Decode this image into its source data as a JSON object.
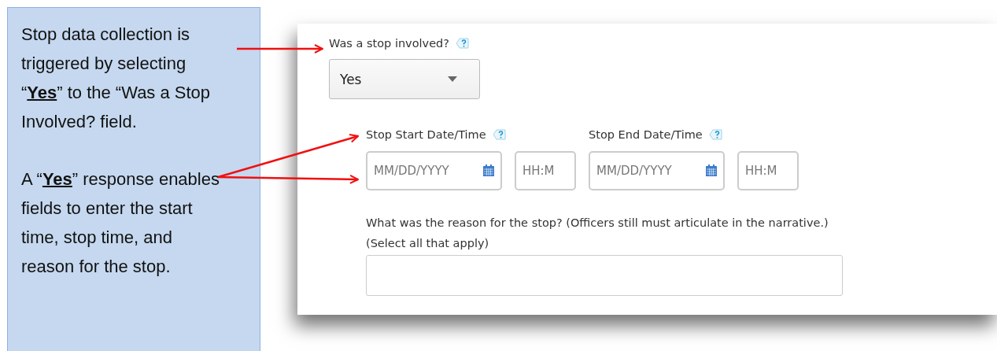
{
  "callout": {
    "paragraphs": [
      "Stop data collection is triggered by selecting “**Yes**” to the “Was a Stop Involved? field.",
      "A “**Yes**” response enables fields to enter the start time, stop time, and reason for the stop."
    ]
  },
  "form": {
    "stop_involved": {
      "label": "Was a stop involved?",
      "value": "Yes"
    },
    "date_times": [
      {
        "label": "Stop Start Date/Time",
        "date_placeholder": "MM/DD/YYYY",
        "time_placeholder": "HH:M"
      },
      {
        "label": "Stop End Date/Time",
        "date_placeholder": "MM/DD/YYYY",
        "time_placeholder": "HH:M"
      }
    ],
    "reason": {
      "label": "What was the reason for the stop? (Officers still must articulate in the narrative.)",
      "hint": "(Select all that apply)"
    }
  }
}
